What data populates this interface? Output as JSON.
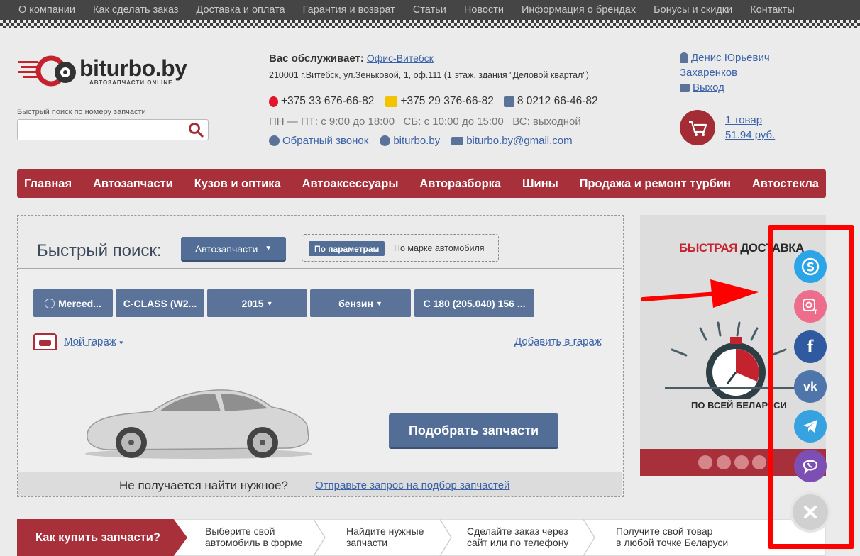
{
  "topnav": [
    "О компании",
    "Как сделать заказ",
    "Доставка и оплата",
    "Гарантия и возврат",
    "Статьи",
    "Новости",
    "Информация о брендах",
    "Бонусы и скидки",
    "Контакты"
  ],
  "logo": {
    "text": "biturbo.by",
    "sub": "АВТОЗАПЧАСТИ ONLINE"
  },
  "quick_search": {
    "label": "Быстрый поиск по номеру запчасти",
    "value": ""
  },
  "contact": {
    "served_by_label": "Вас обслуживает:",
    "office": "Офис-Витебск",
    "address": "210001 г.Витебск, ул.Зеньковой, 1, оф.111 (1 этаж, здания \"Деловой квартал\")",
    "phones": [
      "+375 33 676-66-82",
      "+375 29 376-66-82",
      "8 0212 66-46-82"
    ],
    "hours": "ПН — ПТ: с 9:00 до 18:00   СБ: с 10:00 до 15:00   ВС: выходной",
    "callback": "Обратный звонок",
    "skype": "biturbo.by",
    "email": "biturbo.by@gmail.com"
  },
  "user": {
    "name_line1": "Денис Юрьевич",
    "name_line2": "Захаренков",
    "logout": "Выход"
  },
  "cart": {
    "items": "1 товар",
    "total": "51.94 руб."
  },
  "mainnav": [
    "Главная",
    "Автозапчасти",
    "Кузов и оптика",
    "Автоаксессуары",
    "Авторазборка",
    "Шины",
    "Продажа и ремонт турбин",
    "Автостекла"
  ],
  "search_panel": {
    "title": "Быстрый поиск:",
    "category": "Автозапчасти",
    "mode_params": "По параметрам",
    "mode_brand": "По марке автомобиля",
    "selects": [
      "Merced...",
      "C-CLASS (W2...",
      "2015",
      "бензин",
      "C 180 (205.040) 156 ..."
    ],
    "garage": "Мой гараж",
    "add_garage": "Добавить в гараж",
    "find_button": "Подобрать запчасти",
    "not_found": "Не получается найти нужное?",
    "send_request": "Отправьте запрос на подбор запчастей"
  },
  "banner": {
    "title_red": "БЫСТРАЯ",
    "title_dark": "ДОСТАВКА",
    "bottom": "ПО ВСЕЙ БЕЛАРУСИ"
  },
  "steps": {
    "head": "Как купить запчасти?",
    "items": [
      {
        "l1": "Выберите свой",
        "l2": "автомобиль в форме"
      },
      {
        "l1": "Найдите нужные",
        "l2": "запчасти"
      },
      {
        "l1": "Сделайте заказ через",
        "l2": "сайт или по телефону"
      },
      {
        "l1": "Получите свой товар",
        "l2": "в любой точке Беларуси"
      }
    ]
  },
  "social": [
    "skype-icon",
    "instagram-icon",
    "facebook-icon",
    "vk-icon",
    "telegram-icon",
    "viber-icon",
    "close-icon"
  ],
  "colors": {
    "brand_red": "#a8303a",
    "accent_blue": "#526d96",
    "highlight": "#ff0000"
  }
}
